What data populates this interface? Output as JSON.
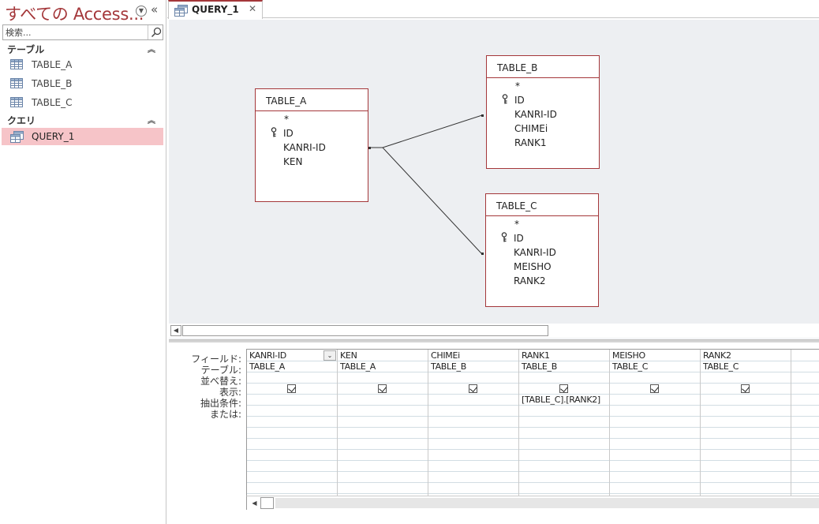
{
  "nav": {
    "title": "すべての Access...",
    "search_placeholder": "検索...",
    "groups": [
      {
        "label": "テーブル",
        "items": [
          "TABLE_A",
          "TABLE_B",
          "TABLE_C"
        ]
      },
      {
        "label": "クエリ",
        "items": [
          "QUERY_1"
        ]
      }
    ]
  },
  "tab": {
    "label": "QUERY_1",
    "close": "✕"
  },
  "diagram": {
    "tables": [
      {
        "name": "TABLE_A",
        "fields": [
          "*",
          "ID",
          "KANRI-ID",
          "KEN"
        ]
      },
      {
        "name": "TABLE_B",
        "fields": [
          "*",
          "ID",
          "KANRI-ID",
          "CHIMEi",
          "RANK1"
        ]
      },
      {
        "name": "TABLE_C",
        "fields": [
          "*",
          "ID",
          "KANRI-ID",
          "MEISHO",
          "RANK2"
        ]
      }
    ]
  },
  "grid": {
    "row_labels": [
      "フィールド:",
      "テーブル:",
      "並べ替え:",
      "表示:",
      "抽出条件:",
      "または:"
    ],
    "columns": [
      {
        "field": "KANRI-ID",
        "table": "TABLE_A",
        "show": true,
        "criteria": ""
      },
      {
        "field": "KEN",
        "table": "TABLE_A",
        "show": true,
        "criteria": ""
      },
      {
        "field": "CHIMEi",
        "table": "TABLE_B",
        "show": true,
        "criteria": ""
      },
      {
        "field": "RANK1",
        "table": "TABLE_B",
        "show": true,
        "criteria": "[TABLE_C].[RANK2]"
      },
      {
        "field": "MEISHO",
        "table": "TABLE_C",
        "show": true,
        "criteria": ""
      },
      {
        "field": "RANK2",
        "table": "TABLE_C",
        "show": true,
        "criteria": ""
      }
    ]
  },
  "colors": {
    "accent": "#a4373a",
    "selected": "#f6c4c8",
    "diagram_bg": "#edeff2"
  }
}
